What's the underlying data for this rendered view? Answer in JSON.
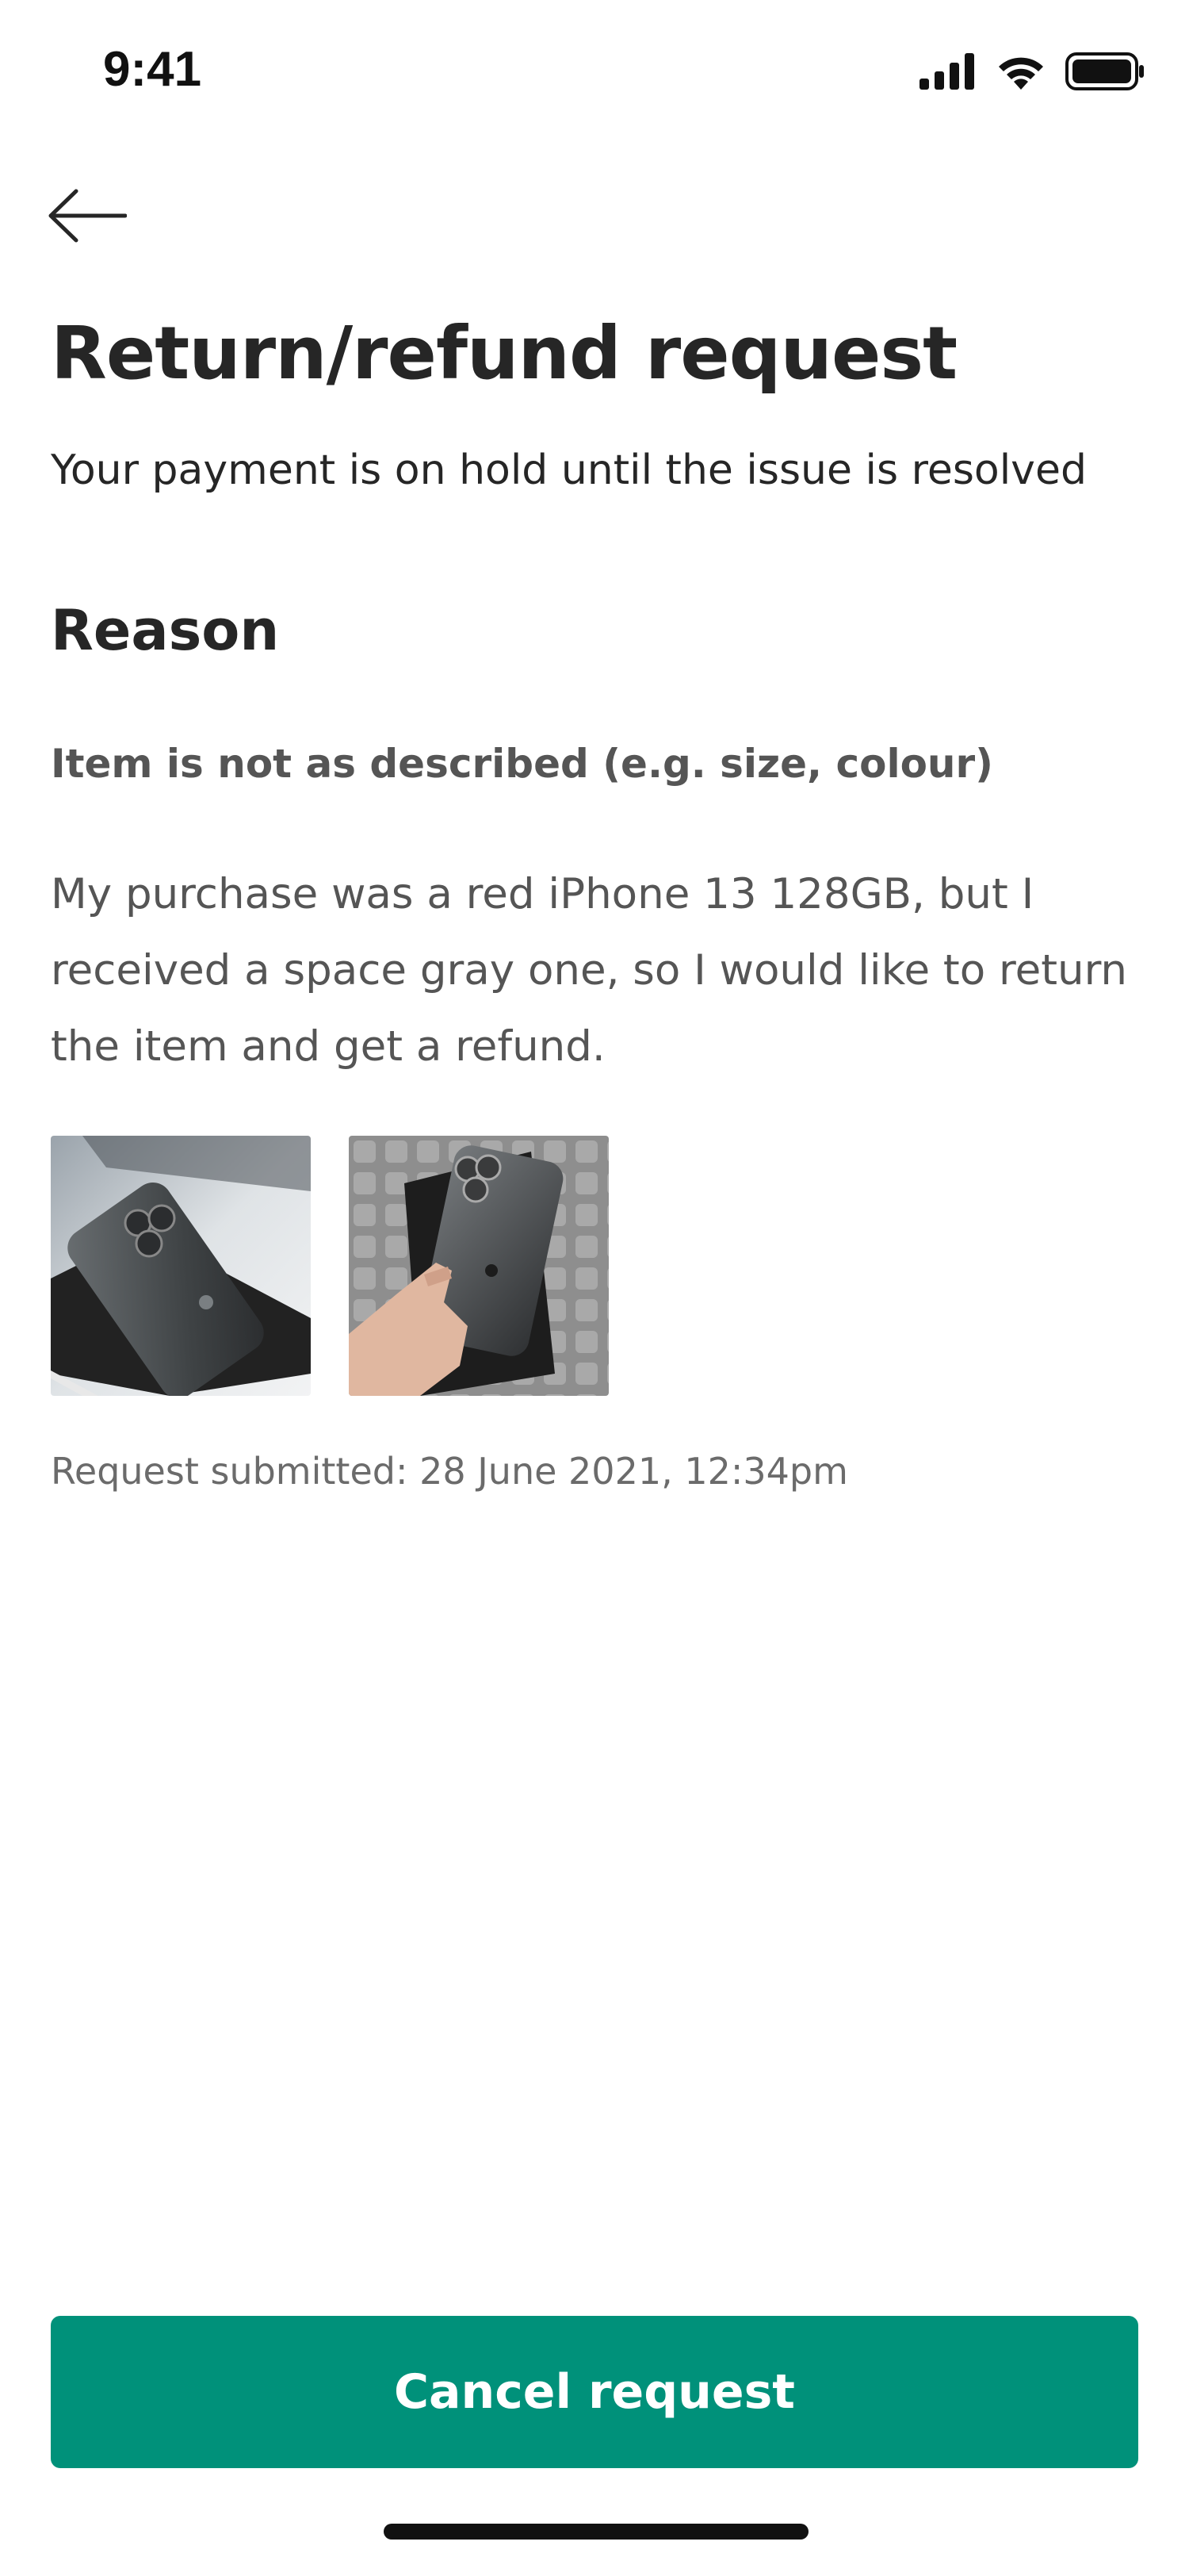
{
  "status_bar": {
    "time": "9:41",
    "icons": [
      "cellular-signal-icon",
      "wifi-icon",
      "battery-icon"
    ]
  },
  "header": {
    "back_icon": "arrow-left-icon",
    "title": "Return/refund request",
    "subtitle": "Your payment is on hold until the issue is resolved"
  },
  "reason": {
    "heading": "Reason",
    "label": "Item is not as described (e.g. size, colour)",
    "description": "My purchase was a red iPhone 13 128GB, but I received a space gray one, so I would like to return the item and get a refund."
  },
  "photos": [
    "space-gray-iphone-on-box-photo",
    "hand-holding-space-gray-iphone-photo"
  ],
  "submitted": {
    "text": "Request submitted:  28 June 2021, 12:34pm"
  },
  "actions": {
    "cancel_label": "Cancel request"
  },
  "colors": {
    "accent": "#00917a",
    "text_primary": "#262626",
    "text_secondary": "#555555"
  }
}
